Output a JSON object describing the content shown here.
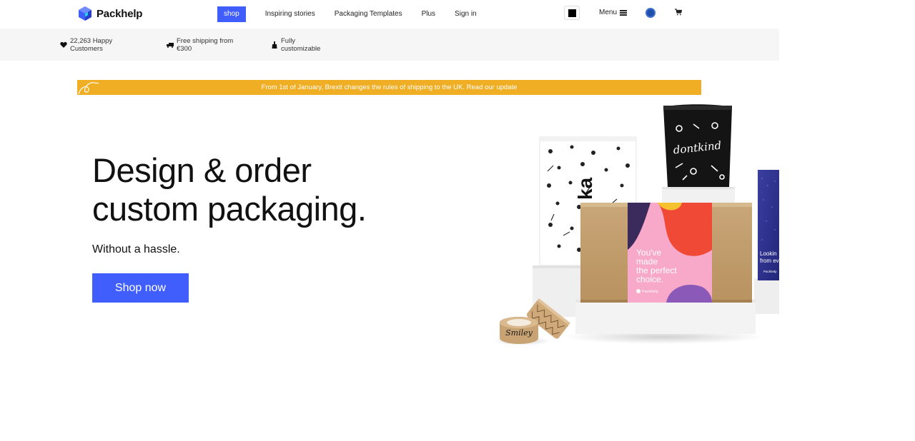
{
  "brand": {
    "name": "Packhelp",
    "accent": "#3f5efb"
  },
  "nav": {
    "items": [
      {
        "label": "shop",
        "active": true
      },
      {
        "label": "Inspiring stories",
        "active": false
      },
      {
        "label": "Packaging Templates",
        "active": false
      },
      {
        "label": "Plus",
        "active": false
      },
      {
        "label": "Sign in",
        "active": false
      }
    ],
    "menu_label": "Menu",
    "icons": [
      "black-square-icon",
      "hamburger-icon",
      "globe-icon",
      "cart-icon"
    ]
  },
  "usps": [
    {
      "icon": "heart-icon",
      "line1": "22,263 Happy",
      "line2": "Customers"
    },
    {
      "icon": "truck-icon",
      "line1": "Free shipping from",
      "line2": "€300"
    },
    {
      "icon": "brush-icon",
      "line1": "Fully",
      "line2": "customizable"
    }
  ],
  "announcement": {
    "text": "From 1st of January, Brexit changes the rules of shipping to the UK. Read our update",
    "color": "#f0ae24"
  },
  "hero": {
    "title_line1": "Design & order",
    "title_line2": "custom packaging.",
    "subtitle": "Without a hassle.",
    "cta": "Shop now"
  },
  "illustration": {
    "tape_text": "Smiley",
    "box_text": "You've made the perfect choice.",
    "box_brand": "Packhelp",
    "bag_text": "dontkind",
    "side_box_text": "ka",
    "partial_box_text1": "Lookin",
    "partial_box_text2": "from ev",
    "partial_box_brand": "Packhelp"
  }
}
